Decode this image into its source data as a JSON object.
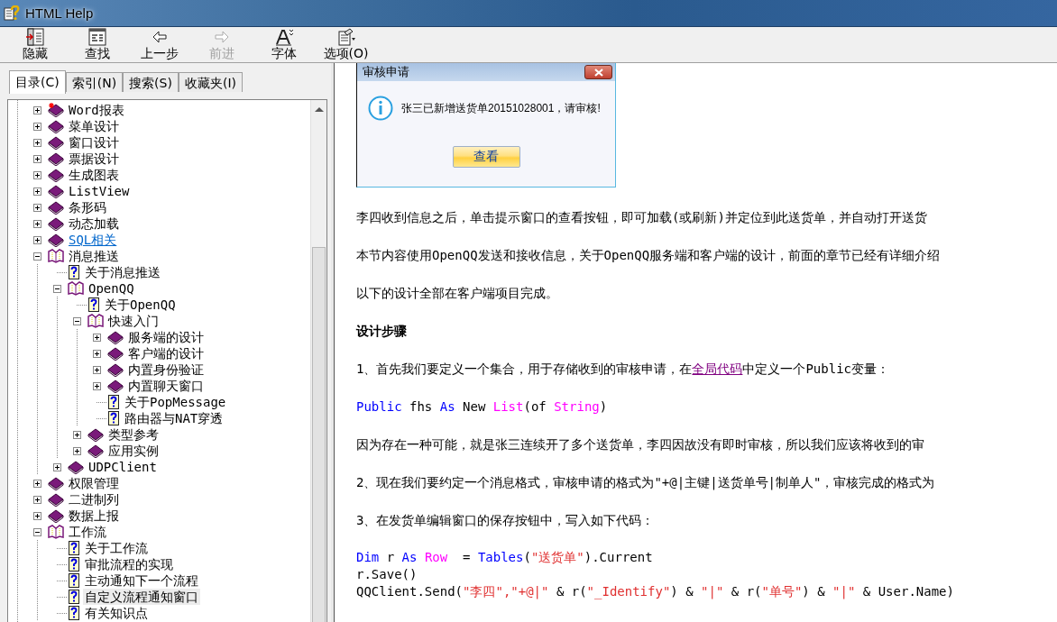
{
  "window": {
    "title": "HTML Help"
  },
  "toolbar": [
    {
      "label": "隐藏",
      "kind": "hide",
      "disabled": false
    },
    {
      "label": "查找",
      "kind": "find",
      "disabled": false
    },
    {
      "label": "上一步",
      "kind": "back",
      "disabled": false
    },
    {
      "label": "前进",
      "kind": "forward",
      "disabled": true
    },
    {
      "label": "字体",
      "kind": "font",
      "disabled": false
    },
    {
      "label": "选项(O)",
      "kind": "options",
      "disabled": false
    }
  ],
  "tabs": [
    {
      "label": "目录(C)",
      "selected": true
    },
    {
      "label": "索引(N)",
      "selected": false
    },
    {
      "label": "搜索(S)",
      "selected": false
    },
    {
      "label": "收藏夹(I)",
      "selected": false
    }
  ],
  "tree": {
    "items": [
      {
        "label": "Word报表",
        "kind": "book",
        "new": true,
        "expanded": false,
        "selected": false
      },
      {
        "label": "菜单设计",
        "kind": "book",
        "expanded": false,
        "selected": false
      },
      {
        "label": "窗口设计",
        "kind": "book",
        "expanded": false,
        "selected": false
      },
      {
        "label": "票据设计",
        "kind": "book",
        "expanded": false,
        "selected": false
      },
      {
        "label": "生成图表",
        "kind": "book",
        "expanded": false,
        "selected": false
      },
      {
        "label": "ListView",
        "kind": "book",
        "expanded": false,
        "selected": false
      },
      {
        "label": "条形码",
        "kind": "book",
        "expanded": false,
        "selected": false
      },
      {
        "label": "动态加载",
        "kind": "book",
        "expanded": false,
        "selected": false
      },
      {
        "label": "SQL相关",
        "kind": "book",
        "link": true,
        "expanded": false,
        "selected": false
      },
      {
        "label": "消息推送",
        "kind": "book",
        "expanded": true,
        "selected": false,
        "children": [
          {
            "label": "关于消息推送",
            "kind": "page",
            "selected": false
          },
          {
            "label": "OpenQQ",
            "kind": "book",
            "expanded": true,
            "selected": false,
            "children": [
              {
                "label": "关于OpenQQ",
                "kind": "page",
                "selected": false
              },
              {
                "label": "快速入门",
                "kind": "book",
                "expanded": true,
                "selected": false,
                "children": [
                  {
                    "label": "服务端的设计",
                    "kind": "book",
                    "expanded": false,
                    "selected": false
                  },
                  {
                    "label": "客户端的设计",
                    "kind": "book",
                    "expanded": false,
                    "selected": false
                  },
                  {
                    "label": "内置身份验证",
                    "kind": "book",
                    "expanded": false,
                    "selected": false
                  },
                  {
                    "label": "内置聊天窗口",
                    "kind": "book",
                    "expanded": false,
                    "selected": false
                  },
                  {
                    "label": "关于PopMessage",
                    "kind": "page",
                    "selected": false
                  },
                  {
                    "label": "路由器与NAT穿透",
                    "kind": "page",
                    "selected": false
                  }
                ]
              },
              {
                "label": "类型参考",
                "kind": "book",
                "expanded": false,
                "selected": false
              },
              {
                "label": "应用实例",
                "kind": "book",
                "expanded": false,
                "selected": false
              }
            ]
          },
          {
            "label": "UDPClient",
            "kind": "book",
            "expanded": false,
            "selected": false
          }
        ]
      },
      {
        "label": "权限管理",
        "kind": "book",
        "expanded": false,
        "selected": false
      },
      {
        "label": "二进制列",
        "kind": "book",
        "expanded": false,
        "selected": false
      },
      {
        "label": "数据上报",
        "kind": "book",
        "expanded": false,
        "selected": false
      },
      {
        "label": "工作流",
        "kind": "book",
        "expanded": true,
        "selected": false,
        "children": [
          {
            "label": "关于工作流",
            "kind": "page",
            "selected": false
          },
          {
            "label": "审批流程的实现",
            "kind": "page",
            "selected": false
          },
          {
            "label": "主动通知下一个流程",
            "kind": "page",
            "selected": false
          },
          {
            "label": "自定义流程通知窗口",
            "kind": "page",
            "selected": true
          },
          {
            "label": "有关知识点",
            "kind": "page",
            "selected": false
          }
        ]
      }
    ]
  },
  "dialog": {
    "title": "审核申请",
    "message": "张三已新增送货单20151028001，请审核!",
    "button": "查看"
  },
  "content": [
    {
      "kind": "para",
      "segments": [
        {
          "kind": "text",
          "text": "李四收到信息之后，单击提示窗口的查看按钮，即可加载(或刷新)并定位到此送货单，并自动打开送货"
        }
      ]
    },
    {
      "kind": "para",
      "segments": [
        {
          "kind": "text",
          "text": "本节内容使用OpenQQ发送和接收信息，关于OpenQQ服务端和客户端的设计，前面的章节已经有详细介绍"
        }
      ]
    },
    {
      "kind": "para",
      "segments": [
        {
          "kind": "text",
          "text": "以下的设计全部在客户端项目完成。"
        }
      ]
    },
    {
      "kind": "heading",
      "segments": [
        {
          "kind": "text",
          "text": "设计步骤"
        }
      ]
    },
    {
      "kind": "para",
      "segments": [
        {
          "kind": "text",
          "text": "1、首先我们要定义一个集合，用于存储收到的审核申请，在"
        },
        {
          "kind": "link",
          "text": "全局代码"
        },
        {
          "kind": "text",
          "text": "中定义一个Public变量："
        }
      ]
    },
    {
      "kind": "code",
      "segments": [
        {
          "kind": "keyword",
          "text": "Public"
        },
        {
          "kind": "text",
          "text": " fhs "
        },
        {
          "kind": "keyword",
          "text": "As"
        },
        {
          "kind": "text",
          "text": " New "
        },
        {
          "kind": "type",
          "text": "List"
        },
        {
          "kind": "text",
          "text": "(of "
        },
        {
          "kind": "type",
          "text": "String"
        },
        {
          "kind": "text",
          "text": ")"
        }
      ]
    },
    {
      "kind": "para",
      "segments": [
        {
          "kind": "text",
          "text": "因为存在一种可能，就是张三连续开了多个送货单，李四因故没有即时审核，所以我们应该将收到的审"
        }
      ]
    },
    {
      "kind": "para",
      "segments": [
        {
          "kind": "text",
          "text": "2、现在我们要约定一个消息格式，审核申请的格式为\"+@|主键|送货单号|制单人\"，审核完成的格式为"
        }
      ]
    },
    {
      "kind": "para",
      "segments": [
        {
          "kind": "text",
          "text": "3、在发货单编辑窗口的保存按钮中，写入如下代码："
        }
      ]
    },
    {
      "kind": "code-block",
      "lines": [
        [
          {
            "kind": "keyword",
            "text": "Dim"
          },
          {
            "kind": "text",
            "text": " r "
          },
          {
            "kind": "keyword",
            "text": "As"
          },
          {
            "kind": "type",
            "text": " Row"
          },
          {
            "kind": "text",
            "text": "  = "
          },
          {
            "kind": "keyword",
            "text": "Tables"
          },
          {
            "kind": "text",
            "text": "("
          },
          {
            "kind": "string",
            "text": "\"送货单\""
          },
          {
            "kind": "text",
            "text": ").Current"
          }
        ],
        [
          {
            "kind": "text",
            "text": "r.Save()"
          }
        ],
        [
          {
            "kind": "text",
            "text": "QQClient.Send("
          },
          {
            "kind": "string",
            "text": "\"李四\""
          },
          {
            "kind": "string",
            "text": ",\"+@|\""
          },
          {
            "kind": "text",
            "text": " & r("
          },
          {
            "kind": "string",
            "text": "\"_Identify\""
          },
          {
            "kind": "text",
            "text": ") & "
          },
          {
            "kind": "string",
            "text": "\"|\""
          },
          {
            "kind": "text",
            "text": " & r("
          },
          {
            "kind": "string",
            "text": "\"单号\""
          },
          {
            "kind": "text",
            "text": ") & "
          },
          {
            "kind": "string",
            "text": "\"|\""
          },
          {
            "kind": "text",
            "text": " & User.Name)"
          }
        ]
      ]
    }
  ]
}
